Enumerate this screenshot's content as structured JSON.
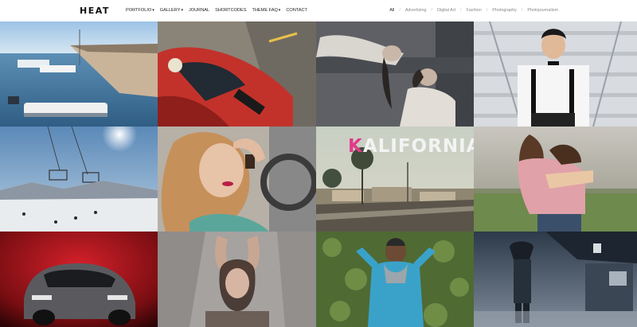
{
  "header": {
    "logo": "HEAT",
    "nav": [
      {
        "label": "PORTFOLIO",
        "caret": "▾"
      },
      {
        "label": "GALLERY",
        "caret": "▾"
      },
      {
        "label": "JOURNAL",
        "caret": ""
      },
      {
        "label": "SHORTCODES",
        "caret": ""
      },
      {
        "label": "THEME FAQ",
        "caret": "▾"
      },
      {
        "label": "CONTACT",
        "caret": ""
      }
    ],
    "filters": [
      "All",
      "Advertising",
      "Digital Art",
      "Fashion",
      "Photography",
      "Photojournalism"
    ],
    "filter_separator": "/"
  },
  "tiles": [
    {
      "name": "harbor-boats"
    },
    {
      "name": "red-sports-car"
    },
    {
      "name": "reclining-woman"
    },
    {
      "name": "man-on-stairs"
    },
    {
      "name": "ski-lift"
    },
    {
      "name": "blonde-woman-portrait"
    },
    {
      "name": "kalifornia",
      "title_first_letter": "K",
      "title_rest": "ALIFORNIA"
    },
    {
      "name": "embracing-couple"
    },
    {
      "name": "red-car-dark"
    },
    {
      "name": "woman-arms-raised"
    },
    {
      "name": "man-in-ivy"
    },
    {
      "name": "foggy-station-man"
    }
  ],
  "colors": {
    "accent_pink": "#e23a8a",
    "text_dark": "#222222",
    "filter_gray": "#888888"
  }
}
